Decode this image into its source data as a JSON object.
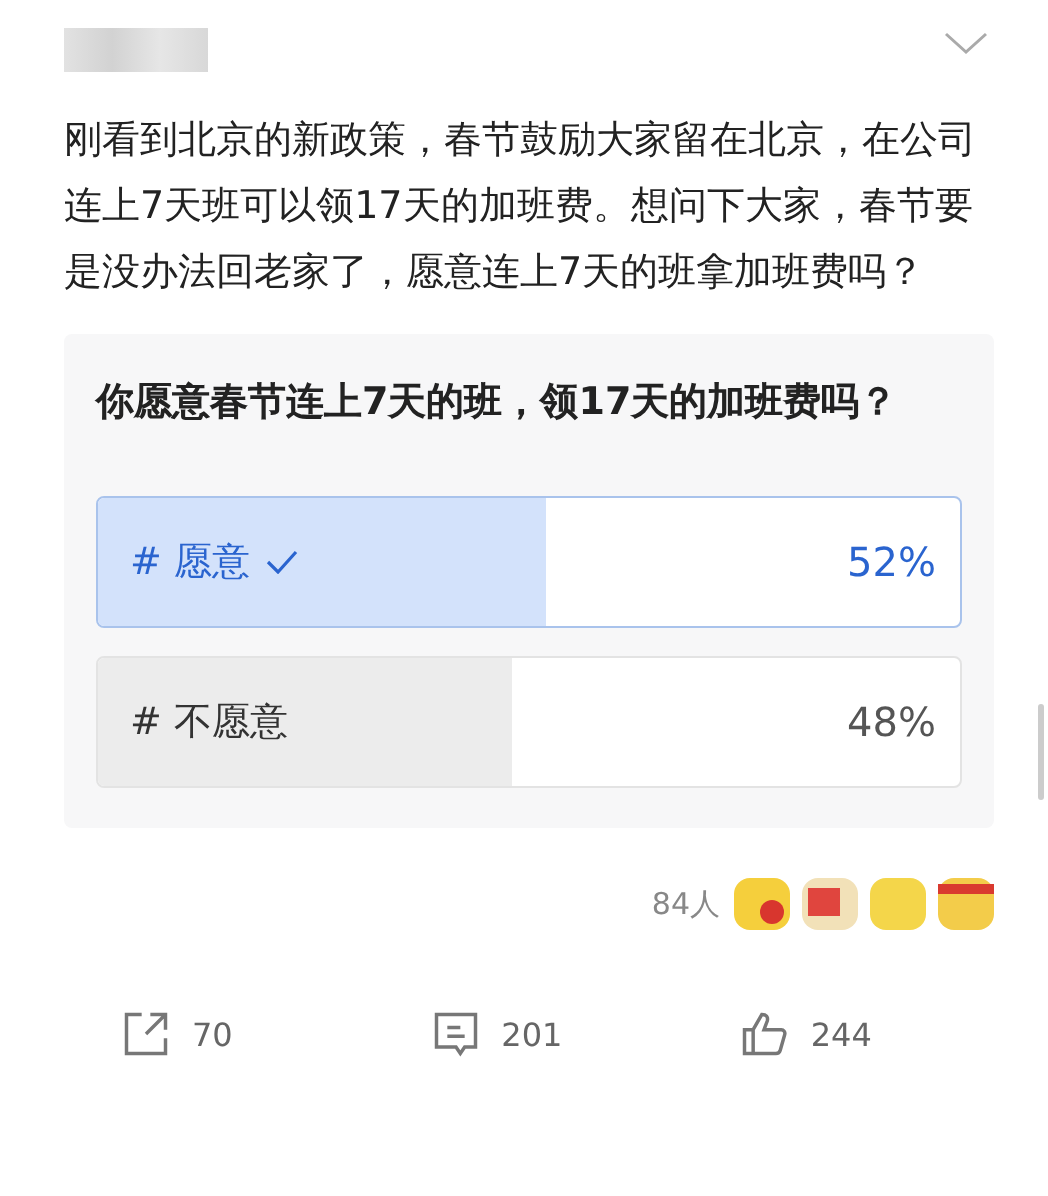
{
  "post": {
    "body": "刚看到北京的新政策，春节鼓励大家留在北京，在公司连上7天班可以领17天的加班费。想问下大家，春节要是没办法回老家了，愿意连上7天的班拿加班费吗？"
  },
  "poll": {
    "question": "你愿意春节连上7天的班，领17天的加班费吗？",
    "options": [
      {
        "label": "# 愿意",
        "selected": true,
        "level": 0.52,
        "percent": "52%"
      },
      {
        "label": "# 不愿意",
        "selected": false,
        "level": 0.48,
        "percent": "48%"
      }
    ]
  },
  "reactions": {
    "count": "84人"
  },
  "actions": [
    {
      "kind": "share",
      "count": "70"
    },
    {
      "kind": "comment",
      "count": "201"
    },
    {
      "kind": "like",
      "count": "244"
    }
  ]
}
